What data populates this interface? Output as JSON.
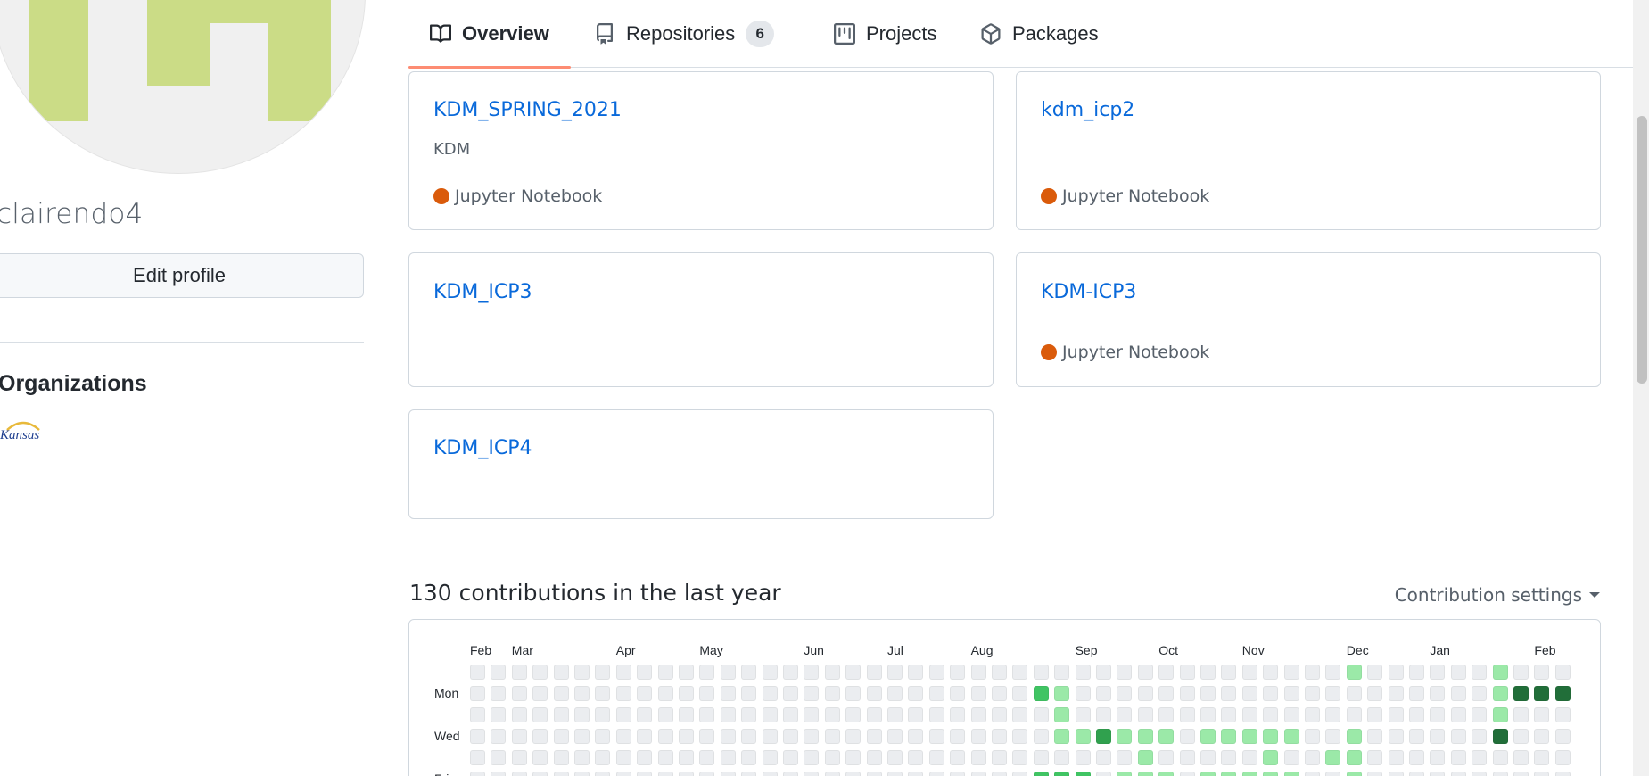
{
  "profile": {
    "username": "clairendo4",
    "edit_profile_label": "Edit profile",
    "organizations_heading": "Organizations",
    "org_logo_text": "Kansas"
  },
  "nav": {
    "tabs": [
      {
        "label": "Overview",
        "icon": "book-icon",
        "active": true
      },
      {
        "label": "Repositories",
        "icon": "repo-icon",
        "count": "6"
      },
      {
        "label": "Projects",
        "icon": "project-icon"
      },
      {
        "label": "Packages",
        "icon": "package-icon"
      }
    ]
  },
  "repos": [
    {
      "name": "KDM_SPRING_2021",
      "description": "KDM",
      "language": "Jupyter Notebook",
      "lang_color": "#DA5B0B"
    },
    {
      "name": "kdm_icp2",
      "description": "",
      "language": "Jupyter Notebook",
      "lang_color": "#DA5B0B"
    },
    {
      "name": "KDM_ICP3",
      "description": "",
      "language": "",
      "lang_color": ""
    },
    {
      "name": "KDM-ICP3",
      "description": "",
      "language": "Jupyter Notebook",
      "lang_color": "#DA5B0B"
    },
    {
      "name": "KDM_ICP4",
      "description": "",
      "language": "",
      "lang_color": ""
    }
  ],
  "contributions": {
    "title": "130 contributions in the last year",
    "settings_label": "Contribution settings",
    "months": [
      "Feb",
      "Mar",
      "Apr",
      "May",
      "Jun",
      "Jul",
      "Aug",
      "Sep",
      "Oct",
      "Nov",
      "Dec",
      "Jan",
      "Feb"
    ],
    "month_start_weeks": [
      0,
      2,
      7,
      11,
      16,
      20,
      24,
      29,
      33,
      37,
      42,
      46,
      51
    ],
    "day_labels": [
      "Mon",
      "Wed",
      "Fri"
    ],
    "colors": [
      "#ebedf0",
      "#9be9a8",
      "#40c463",
      "#30a14e",
      "#216e39"
    ],
    "levels": [
      [
        0,
        0,
        0,
        0,
        0,
        0,
        0,
        0,
        0,
        0,
        0,
        0,
        0,
        0,
        0,
        0,
        0,
        0,
        0,
        0,
        0,
        0,
        0,
        0,
        0,
        0,
        0,
        0,
        0,
        0,
        0,
        0,
        0,
        0,
        0,
        0,
        0,
        0,
        0,
        0,
        0,
        0,
        1,
        0,
        0,
        0,
        0,
        0,
        0,
        1,
        0,
        0,
        0
      ],
      [
        0,
        0,
        0,
        0,
        0,
        0,
        0,
        0,
        0,
        0,
        0,
        0,
        0,
        0,
        0,
        0,
        0,
        0,
        0,
        0,
        0,
        0,
        0,
        0,
        0,
        0,
        0,
        2,
        1,
        0,
        0,
        0,
        0,
        0,
        0,
        0,
        0,
        0,
        0,
        0,
        0,
        0,
        0,
        0,
        0,
        0,
        0,
        0,
        0,
        1,
        4,
        4,
        4
      ],
      [
        0,
        0,
        0,
        0,
        0,
        0,
        0,
        0,
        0,
        0,
        0,
        0,
        0,
        0,
        0,
        0,
        0,
        0,
        0,
        0,
        0,
        0,
        0,
        0,
        0,
        0,
        0,
        0,
        1,
        0,
        0,
        0,
        0,
        0,
        0,
        0,
        0,
        0,
        0,
        0,
        0,
        0,
        0,
        0,
        0,
        0,
        0,
        0,
        0,
        1,
        0,
        0,
        0
      ],
      [
        0,
        0,
        0,
        0,
        0,
        0,
        0,
        0,
        0,
        0,
        0,
        0,
        0,
        0,
        0,
        0,
        0,
        0,
        0,
        0,
        0,
        0,
        0,
        0,
        0,
        0,
        0,
        0,
        1,
        1,
        3,
        1,
        1,
        1,
        0,
        1,
        1,
        1,
        1,
        1,
        0,
        0,
        1,
        0,
        0,
        0,
        0,
        0,
        0,
        4,
        0,
        0,
        0
      ],
      [
        0,
        0,
        0,
        0,
        0,
        0,
        0,
        0,
        0,
        0,
        0,
        0,
        0,
        0,
        0,
        0,
        0,
        0,
        0,
        0,
        0,
        0,
        0,
        0,
        0,
        0,
        0,
        0,
        0,
        0,
        0,
        0,
        1,
        0,
        0,
        0,
        0,
        0,
        1,
        0,
        0,
        1,
        1,
        0,
        0,
        0,
        0,
        0,
        0,
        0,
        0,
        0,
        0
      ],
      [
        0,
        0,
        0,
        0,
        0,
        0,
        0,
        0,
        0,
        0,
        0,
        0,
        0,
        0,
        0,
        0,
        0,
        0,
        0,
        0,
        0,
        0,
        0,
        0,
        0,
        0,
        0,
        2,
        2,
        2,
        0,
        1,
        1,
        1,
        0,
        1,
        1,
        1,
        1,
        1,
        0,
        0,
        1,
        0,
        0,
        0,
        0,
        0,
        0,
        0,
        0,
        0,
        0
      ]
    ]
  }
}
